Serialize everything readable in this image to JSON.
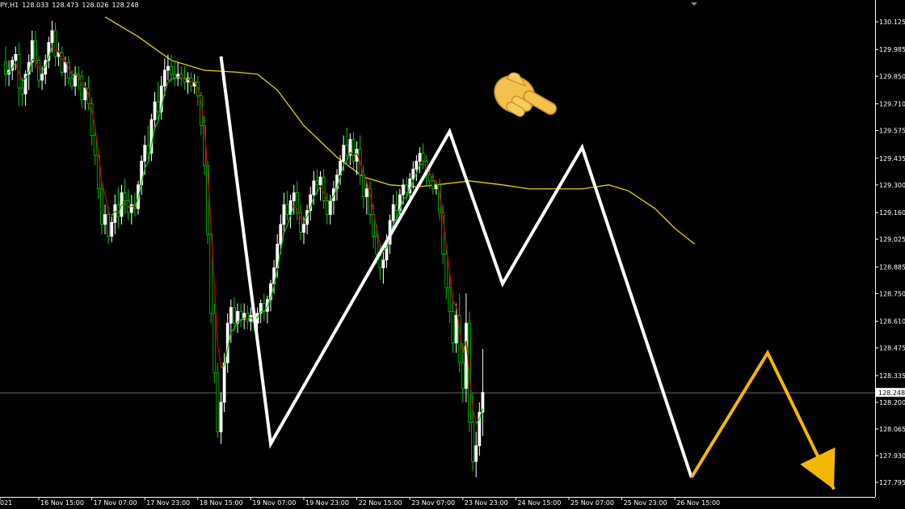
{
  "header": {
    "symbol": "PY,H1",
    "open": "128.033",
    "high": "128.473",
    "low": "128.026",
    "close": "128.248"
  },
  "colors": {
    "background": "#000000",
    "frame": "#ffffff",
    "bull_candle": "#ffffff",
    "bear_candle": "#00c800",
    "ema_fast_up": "#00c800",
    "ema_fast_down": "#c80000",
    "sma_slow": "#e6d200",
    "zigzag": "#ffffff",
    "projection": "#f5b800",
    "price_line": "#787878"
  },
  "chart_data": {
    "type": "line",
    "title": "",
    "xlabel": "",
    "ylabel": "",
    "ylim": [
      127.74,
      130.2
    ],
    "grid": false,
    "current_price": "128.248",
    "x_tick_labels": [
      "021",
      "16 Nov 15:00",
      "17 Nov 07:00",
      "17 Nov 23:00",
      "18 Nov 15:00",
      "19 Nov 07:00",
      "19 Nov 23:00",
      "22 Nov 15:00",
      "23 Nov 07:00",
      "23 Nov 23:00",
      "24 Nov 15:00",
      "25 Nov 07:00",
      "25 Nov 23:00",
      "26 Nov 15:00"
    ],
    "x_tick_bars": [
      0,
      10,
      26,
      42,
      58,
      74,
      90,
      106,
      122,
      138,
      154,
      170,
      186,
      202
    ],
    "y_tick_labels": [
      "130.125",
      "129.985",
      "129.850",
      "129.710",
      "129.575",
      "129.435",
      "129.300",
      "129.160",
      "129.025",
      "128.885",
      "128.750",
      "128.610",
      "128.475",
      "128.335",
      "128.200",
      "128.065",
      "127.930",
      "127.795"
    ],
    "y_ticks": [
      130.125,
      129.985,
      129.85,
      129.71,
      129.575,
      129.435,
      129.3,
      129.16,
      129.025,
      128.885,
      128.75,
      128.61,
      128.475,
      128.335,
      128.2,
      128.065,
      127.93,
      127.795
    ],
    "zigzag": {
      "name": "",
      "bars": [
        65,
        80,
        134,
        150,
        174,
        207
      ],
      "values": [
        129.95,
        127.99,
        129.57,
        128.8,
        129.49,
        127.82
      ]
    },
    "projection": {
      "name": "",
      "bars": [
        207,
        230,
        250
      ],
      "values": [
        127.82,
        128.45,
        127.76
      ]
    },
    "sma_slow": {
      "name": "",
      "bars": [
        30,
        40,
        50,
        60,
        70,
        76,
        82,
        90,
        100,
        108,
        116,
        124,
        130,
        140,
        150,
        158,
        166,
        174,
        182,
        188,
        196,
        202,
        208
      ],
      "values": [
        130.15,
        130.05,
        129.93,
        129.88,
        129.87,
        129.86,
        129.78,
        129.6,
        129.44,
        129.34,
        129.3,
        129.29,
        129.3,
        129.32,
        129.3,
        129.28,
        129.28,
        129.28,
        129.3,
        129.27,
        129.18,
        129.08,
        129.0
      ]
    },
    "candles": [
      {
        "o": 129.92,
        "h": 130.0,
        "l": 129.8,
        "c": 129.86
      },
      {
        "o": 129.86,
        "h": 129.93,
        "l": 129.8,
        "c": 129.88
      },
      {
        "o": 129.88,
        "h": 129.95,
        "l": 129.83,
        "c": 129.93
      },
      {
        "o": 129.93,
        "h": 130.0,
        "l": 129.88,
        "c": 129.96
      },
      {
        "o": 129.96,
        "h": 130.02,
        "l": 129.7,
        "c": 129.79
      },
      {
        "o": 129.79,
        "h": 129.84,
        "l": 129.7,
        "c": 129.76
      },
      {
        "o": 129.76,
        "h": 129.88,
        "l": 129.7,
        "c": 129.86
      },
      {
        "o": 129.86,
        "h": 129.96,
        "l": 129.78,
        "c": 129.92
      },
      {
        "o": 129.92,
        "h": 130.08,
        "l": 129.87,
        "c": 130.03
      },
      {
        "o": 130.03,
        "h": 130.08,
        "l": 129.89,
        "c": 129.93
      },
      {
        "o": 129.93,
        "h": 129.95,
        "l": 129.79,
        "c": 129.83
      },
      {
        "o": 129.83,
        "h": 129.9,
        "l": 129.78,
        "c": 129.86
      },
      {
        "o": 129.86,
        "h": 129.96,
        "l": 129.81,
        "c": 129.93
      },
      {
        "o": 129.93,
        "h": 130.05,
        "l": 129.89,
        "c": 130.02
      },
      {
        "o": 130.02,
        "h": 130.13,
        "l": 129.97,
        "c": 130.08
      },
      {
        "o": 130.08,
        "h": 130.12,
        "l": 129.9,
        "c": 129.95
      },
      {
        "o": 129.95,
        "h": 130.02,
        "l": 129.9,
        "c": 129.97
      },
      {
        "o": 129.97,
        "h": 130.0,
        "l": 129.85,
        "c": 129.87
      },
      {
        "o": 129.87,
        "h": 129.95,
        "l": 129.8,
        "c": 129.92
      },
      {
        "o": 129.92,
        "h": 129.95,
        "l": 129.81,
        "c": 129.84
      },
      {
        "o": 129.84,
        "h": 129.88,
        "l": 129.78,
        "c": 129.8
      },
      {
        "o": 129.8,
        "h": 129.9,
        "l": 129.75,
        "c": 129.86
      },
      {
        "o": 129.86,
        "h": 129.9,
        "l": 129.78,
        "c": 129.85
      },
      {
        "o": 129.85,
        "h": 129.88,
        "l": 129.69,
        "c": 129.73
      },
      {
        "o": 129.73,
        "h": 129.82,
        "l": 129.68,
        "c": 129.79
      },
      {
        "o": 129.79,
        "h": 129.85,
        "l": 129.68,
        "c": 129.71
      },
      {
        "o": 129.71,
        "h": 129.74,
        "l": 129.5,
        "c": 129.55
      },
      {
        "o": 129.55,
        "h": 129.6,
        "l": 129.4,
        "c": 129.45
      },
      {
        "o": 129.45,
        "h": 129.48,
        "l": 129.23,
        "c": 129.28
      },
      {
        "o": 129.28,
        "h": 129.32,
        "l": 129.05,
        "c": 129.1
      },
      {
        "o": 129.1,
        "h": 129.2,
        "l": 129.05,
        "c": 129.15
      },
      {
        "o": 129.15,
        "h": 129.19,
        "l": 129.0,
        "c": 129.04
      },
      {
        "o": 129.04,
        "h": 129.14,
        "l": 129.01,
        "c": 129.11
      },
      {
        "o": 129.11,
        "h": 129.25,
        "l": 129.05,
        "c": 129.2
      },
      {
        "o": 129.2,
        "h": 129.29,
        "l": 129.08,
        "c": 129.14
      },
      {
        "o": 129.14,
        "h": 129.3,
        "l": 129.1,
        "c": 129.26
      },
      {
        "o": 129.26,
        "h": 129.33,
        "l": 129.15,
        "c": 129.22
      },
      {
        "o": 129.22,
        "h": 129.28,
        "l": 129.12,
        "c": 129.16
      },
      {
        "o": 129.16,
        "h": 129.25,
        "l": 129.1,
        "c": 129.2
      },
      {
        "o": 129.2,
        "h": 129.26,
        "l": 129.14,
        "c": 129.18
      },
      {
        "o": 129.18,
        "h": 129.32,
        "l": 129.15,
        "c": 129.3
      },
      {
        "o": 129.3,
        "h": 129.45,
        "l": 129.25,
        "c": 129.42
      },
      {
        "o": 129.42,
        "h": 129.55,
        "l": 129.35,
        "c": 129.5
      },
      {
        "o": 129.5,
        "h": 129.6,
        "l": 129.43,
        "c": 129.46
      },
      {
        "o": 129.46,
        "h": 129.66,
        "l": 129.42,
        "c": 129.63
      },
      {
        "o": 129.63,
        "h": 129.77,
        "l": 129.58,
        "c": 129.72
      },
      {
        "o": 129.72,
        "h": 129.82,
        "l": 129.62,
        "c": 129.67
      },
      {
        "o": 129.67,
        "h": 129.85,
        "l": 129.63,
        "c": 129.8
      },
      {
        "o": 129.8,
        "h": 129.94,
        "l": 129.75,
        "c": 129.88
      },
      {
        "o": 129.88,
        "h": 129.96,
        "l": 129.83,
        "c": 129.9
      },
      {
        "o": 129.9,
        "h": 129.96,
        "l": 129.82,
        "c": 129.86
      },
      {
        "o": 129.86,
        "h": 129.93,
        "l": 129.8,
        "c": 129.84
      },
      {
        "o": 129.84,
        "h": 129.92,
        "l": 129.8,
        "c": 129.86
      },
      {
        "o": 129.86,
        "h": 129.9,
        "l": 129.8,
        "c": 129.84
      },
      {
        "o": 129.84,
        "h": 129.9,
        "l": 129.78,
        "c": 129.82
      },
      {
        "o": 129.82,
        "h": 129.87,
        "l": 129.76,
        "c": 129.84
      },
      {
        "o": 129.84,
        "h": 129.87,
        "l": 129.77,
        "c": 129.8
      },
      {
        "o": 129.8,
        "h": 129.86,
        "l": 129.76,
        "c": 129.82
      },
      {
        "o": 129.82,
        "h": 129.85,
        "l": 129.7,
        "c": 129.75
      },
      {
        "o": 129.75,
        "h": 129.77,
        "l": 129.55,
        "c": 129.6
      },
      {
        "o": 129.6,
        "h": 129.65,
        "l": 129.35,
        "c": 129.4
      },
      {
        "o": 129.4,
        "h": 129.42,
        "l": 129.0,
        "c": 129.05
      },
      {
        "o": 129.05,
        "h": 129.09,
        "l": 128.6,
        "c": 128.65
      },
      {
        "o": 128.65,
        "h": 128.7,
        "l": 128.3,
        "c": 128.35
      },
      {
        "o": 128.35,
        "h": 128.4,
        "l": 128.02,
        "c": 128.05
      },
      {
        "o": 128.05,
        "h": 128.25,
        "l": 127.99,
        "c": 128.2
      },
      {
        "o": 128.2,
        "h": 128.45,
        "l": 128.15,
        "c": 128.4
      },
      {
        "o": 128.4,
        "h": 128.65,
        "l": 128.35,
        "c": 128.6
      },
      {
        "o": 128.6,
        "h": 128.72,
        "l": 128.5,
        "c": 128.68
      },
      {
        "o": 128.68,
        "h": 128.73,
        "l": 128.56,
        "c": 128.6
      },
      {
        "o": 128.6,
        "h": 128.7,
        "l": 128.55,
        "c": 128.66
      },
      {
        "o": 128.66,
        "h": 128.7,
        "l": 128.58,
        "c": 128.62
      },
      {
        "o": 128.62,
        "h": 128.7,
        "l": 128.57,
        "c": 128.65
      },
      {
        "o": 128.65,
        "h": 128.69,
        "l": 128.57,
        "c": 128.61
      },
      {
        "o": 128.61,
        "h": 128.68,
        "l": 128.56,
        "c": 128.64
      },
      {
        "o": 128.64,
        "h": 128.7,
        "l": 128.56,
        "c": 128.6
      },
      {
        "o": 128.6,
        "h": 128.68,
        "l": 128.55,
        "c": 128.65
      },
      {
        "o": 128.65,
        "h": 128.72,
        "l": 128.6,
        "c": 128.7
      },
      {
        "o": 128.7,
        "h": 128.75,
        "l": 128.61,
        "c": 128.66
      },
      {
        "o": 128.66,
        "h": 128.74,
        "l": 128.6,
        "c": 128.72
      },
      {
        "o": 128.72,
        "h": 128.82,
        "l": 128.66,
        "c": 128.8
      },
      {
        "o": 128.8,
        "h": 128.92,
        "l": 128.75,
        "c": 128.88
      },
      {
        "o": 128.88,
        "h": 129.05,
        "l": 128.83,
        "c": 129.0
      },
      {
        "o": 129.0,
        "h": 129.15,
        "l": 128.95,
        "c": 129.1
      },
      {
        "o": 129.1,
        "h": 129.26,
        "l": 129.05,
        "c": 129.2
      },
      {
        "o": 129.2,
        "h": 129.27,
        "l": 129.12,
        "c": 129.15
      },
      {
        "o": 129.15,
        "h": 129.25,
        "l": 129.08,
        "c": 129.22
      },
      {
        "o": 129.22,
        "h": 129.3,
        "l": 129.15,
        "c": 129.26
      },
      {
        "o": 129.26,
        "h": 129.32,
        "l": 129.12,
        "c": 129.16
      },
      {
        "o": 129.16,
        "h": 129.2,
        "l": 129.02,
        "c": 129.06
      },
      {
        "o": 129.06,
        "h": 129.14,
        "l": 129.0,
        "c": 129.1
      },
      {
        "o": 129.1,
        "h": 129.2,
        "l": 129.05,
        "c": 129.17
      },
      {
        "o": 129.17,
        "h": 129.29,
        "l": 129.12,
        "c": 129.25
      },
      {
        "o": 129.25,
        "h": 129.37,
        "l": 129.2,
        "c": 129.32
      },
      {
        "o": 129.32,
        "h": 129.38,
        "l": 129.25,
        "c": 129.3
      },
      {
        "o": 129.3,
        "h": 129.37,
        "l": 129.22,
        "c": 129.34
      },
      {
        "o": 129.34,
        "h": 129.38,
        "l": 129.18,
        "c": 129.22
      },
      {
        "o": 129.22,
        "h": 129.26,
        "l": 129.1,
        "c": 129.15
      },
      {
        "o": 129.15,
        "h": 129.25,
        "l": 129.1,
        "c": 129.22
      },
      {
        "o": 129.22,
        "h": 129.32,
        "l": 129.15,
        "c": 129.28
      },
      {
        "o": 129.28,
        "h": 129.38,
        "l": 129.22,
        "c": 129.35
      },
      {
        "o": 129.35,
        "h": 129.45,
        "l": 129.3,
        "c": 129.42
      },
      {
        "o": 129.42,
        "h": 129.55,
        "l": 129.37,
        "c": 129.5
      },
      {
        "o": 129.5,
        "h": 129.59,
        "l": 129.4,
        "c": 129.45
      },
      {
        "o": 129.45,
        "h": 129.56,
        "l": 129.4,
        "c": 129.53
      },
      {
        "o": 129.53,
        "h": 129.57,
        "l": 129.38,
        "c": 129.42
      },
      {
        "o": 129.42,
        "h": 129.52,
        "l": 129.35,
        "c": 129.48
      },
      {
        "o": 129.48,
        "h": 129.55,
        "l": 129.3,
        "c": 129.35
      },
      {
        "o": 129.35,
        "h": 129.4,
        "l": 129.18,
        "c": 129.24
      },
      {
        "o": 129.24,
        "h": 129.32,
        "l": 129.15,
        "c": 129.28
      },
      {
        "o": 129.28,
        "h": 129.32,
        "l": 129.1,
        "c": 129.15
      },
      {
        "o": 129.15,
        "h": 129.2,
        "l": 128.98,
        "c": 129.04
      },
      {
        "o": 129.04,
        "h": 129.1,
        "l": 128.9,
        "c": 128.95
      },
      {
        "o": 128.95,
        "h": 129.0,
        "l": 128.82,
        "c": 128.88
      },
      {
        "o": 128.88,
        "h": 128.96,
        "l": 128.8,
        "c": 128.92
      },
      {
        "o": 128.92,
        "h": 129.05,
        "l": 128.88,
        "c": 129.0
      },
      {
        "o": 129.0,
        "h": 129.15,
        "l": 128.95,
        "c": 129.12
      },
      {
        "o": 129.12,
        "h": 129.25,
        "l": 129.08,
        "c": 129.2
      },
      {
        "o": 129.2,
        "h": 129.27,
        "l": 129.12,
        "c": 129.17
      },
      {
        "o": 129.17,
        "h": 129.28,
        "l": 129.12,
        "c": 129.25
      },
      {
        "o": 129.25,
        "h": 129.33,
        "l": 129.2,
        "c": 129.3
      },
      {
        "o": 129.3,
        "h": 129.34,
        "l": 129.22,
        "c": 129.26
      },
      {
        "o": 129.26,
        "h": 129.36,
        "l": 129.22,
        "c": 129.33
      },
      {
        "o": 129.33,
        "h": 129.42,
        "l": 129.28,
        "c": 129.38
      },
      {
        "o": 129.38,
        "h": 129.45,
        "l": 129.32,
        "c": 129.42
      },
      {
        "o": 129.42,
        "h": 129.49,
        "l": 129.36,
        "c": 129.46
      },
      {
        "o": 129.46,
        "h": 129.51,
        "l": 129.38,
        "c": 129.42
      },
      {
        "o": 129.42,
        "h": 129.45,
        "l": 129.3,
        "c": 129.35
      },
      {
        "o": 129.35,
        "h": 129.4,
        "l": 129.28,
        "c": 129.32
      },
      {
        "o": 129.32,
        "h": 129.36,
        "l": 129.25,
        "c": 129.28
      },
      {
        "o": 129.28,
        "h": 129.32,
        "l": 129.25,
        "c": 129.3
      },
      {
        "o": 129.3,
        "h": 129.33,
        "l": 129.12,
        "c": 129.16
      },
      {
        "o": 129.16,
        "h": 129.2,
        "l": 128.9,
        "c": 128.95
      },
      {
        "o": 128.95,
        "h": 129.0,
        "l": 128.72,
        "c": 128.78
      },
      {
        "o": 128.78,
        "h": 128.85,
        "l": 128.6,
        "c": 128.66
      },
      {
        "o": 128.66,
        "h": 128.72,
        "l": 128.45,
        "c": 128.5
      },
      {
        "o": 128.5,
        "h": 128.7,
        "l": 128.45,
        "c": 128.64
      },
      {
        "o": 128.64,
        "h": 128.75,
        "l": 128.35,
        "c": 128.4
      },
      {
        "o": 128.4,
        "h": 128.5,
        "l": 128.2,
        "c": 128.27
      },
      {
        "o": 128.27,
        "h": 128.75,
        "l": 128.2,
        "c": 128.6
      },
      {
        "o": 128.6,
        "h": 128.66,
        "l": 128.05,
        "c": 128.1
      },
      {
        "o": 128.1,
        "h": 128.25,
        "l": 127.85,
        "c": 127.9
      },
      {
        "o": 127.9,
        "h": 128.05,
        "l": 127.82,
        "c": 127.98
      },
      {
        "o": 127.98,
        "h": 128.2,
        "l": 127.93,
        "c": 128.15
      },
      {
        "o": 128.15,
        "h": 128.47,
        "l": 128.03,
        "c": 128.25
      }
    ]
  }
}
